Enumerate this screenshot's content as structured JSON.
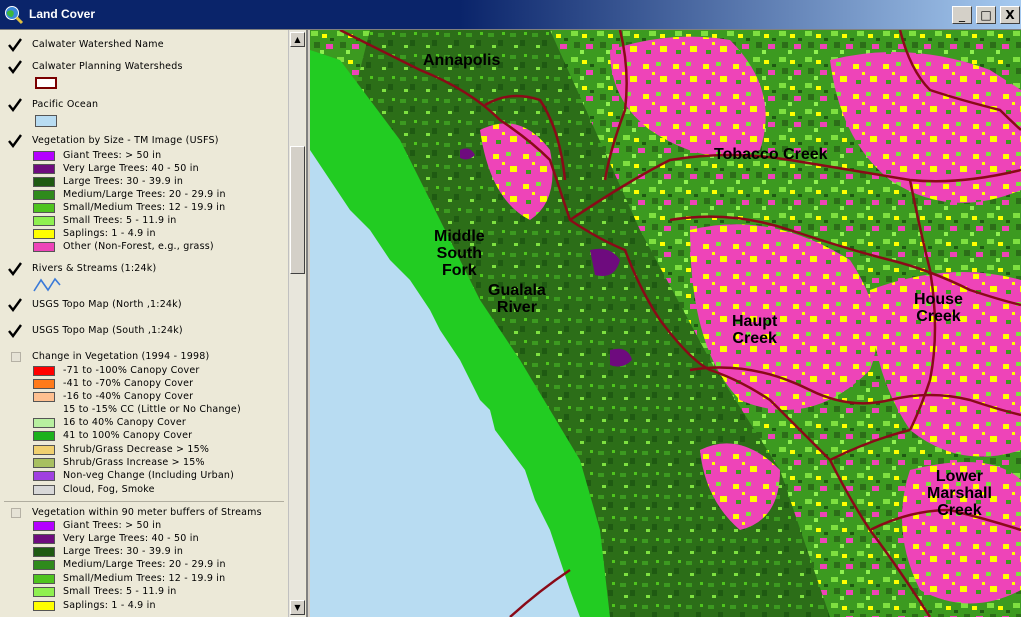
{
  "window": {
    "title": "Land Cover",
    "buttons": {
      "minimize": "_",
      "maximize": "□",
      "close": "X"
    }
  },
  "legend": {
    "layers": [
      {
        "name": "Calwater Watershed Name",
        "checked": true
      },
      {
        "name": "Calwater Planning Watersheds",
        "checked": true,
        "swatch": "#ffffff",
        "swatch_border": "#7a0000"
      },
      {
        "name": "Pacific Ocean",
        "checked": true,
        "swatch": "#b8dcf2"
      },
      {
        "name": "Vegetation by Size - TM Image (USFS)",
        "checked": true,
        "classes": [
          {
            "label": "Giant Trees: > 50 in",
            "color": "#b400ff"
          },
          {
            "label": "Very Large Trees: 40 - 50 in",
            "color": "#6e0b7e"
          },
          {
            "label": "Large Trees: 30 - 39.9 in",
            "color": "#1f5a12"
          },
          {
            "label": "Medium/Large Trees: 20 - 29.9 in",
            "color": "#2f8a1c"
          },
          {
            "label": "Small/Medium Trees: 12 - 19.9 in",
            "color": "#4fc41e"
          },
          {
            "label": "Small Trees: 5 - 11.9 in",
            "color": "#8ff050"
          },
          {
            "label": "Saplings: 1 - 4.9 in",
            "color": "#ffff00"
          },
          {
            "label": "Other (Non-Forest, e.g., grass)",
            "color": "#ee44b8"
          }
        ]
      },
      {
        "name": "Rivers & Streams (1:24k)",
        "checked": true,
        "line_color": "#3a7ad8"
      },
      {
        "name": "USGS Topo Map (North ,1:24k)",
        "checked": true
      },
      {
        "name": "USGS Topo Map (South ,1:24k)",
        "checked": true
      },
      {
        "name": "Change in Vegetation (1994 - 1998)",
        "checked": false,
        "classes": [
          {
            "label": "-71 to -100% Canopy Cover",
            "color": "#ff0000"
          },
          {
            "label": "-41 to -70% Canopy Cover",
            "color": "#ff7a1a"
          },
          {
            "label": "-16 to -40% Canopy Cover",
            "color": "#ffc090"
          },
          {
            "label": "15 to -15% CC (Little or No Change)",
            "color": ""
          },
          {
            "label": "16 to 40% Canopy Cover",
            "color": "#b8f0a0"
          },
          {
            "label": "41 to 100% Canopy Cover",
            "color": "#1cb11c"
          },
          {
            "label": "Shrub/Grass Decrease > 15%",
            "color": "#f0d070"
          },
          {
            "label": "Shrub/Grass Increase > 15%",
            "color": "#a8c060"
          },
          {
            "label": "Non-veg Change (Including Urban)",
            "color": "#a040e0"
          },
          {
            "label": "Cloud, Fog, Smoke",
            "color": "#d8d8d8"
          }
        ]
      },
      {
        "name": "Vegetation within 90 meter buffers of Streams",
        "checked": false,
        "classes": [
          {
            "label": "Giant Trees: > 50 in",
            "color": "#b400ff"
          },
          {
            "label": "Very Large Trees: 40 - 50 in",
            "color": "#6e0b7e"
          },
          {
            "label": "Large Trees: 30 - 39.9 in",
            "color": "#1f5a12"
          },
          {
            "label": "Medium/Large Trees: 20 - 29.9 in",
            "color": "#2f8a1c"
          },
          {
            "label": "Small/Medium Trees: 12 - 19.9 in",
            "color": "#4fc41e"
          },
          {
            "label": "Small Trees: 5 - 11.9 in",
            "color": "#8ff050"
          },
          {
            "label": "Saplings: 1 - 4.9 in",
            "color": "#ffff00"
          }
        ]
      }
    ]
  },
  "map": {
    "labels": [
      {
        "id": "annapolis",
        "text": "Annapolis"
      },
      {
        "id": "tobacco-creek",
        "text": "Tobacco Creek"
      },
      {
        "id": "middle-south-fork",
        "text": "Middle\nSouth\nFork"
      },
      {
        "id": "gualala-river",
        "text": "Gualala\nRiver"
      },
      {
        "id": "haupt-creek",
        "text": "Haupt\nCreek"
      },
      {
        "id": "house-creek",
        "text": "House\nCreek"
      },
      {
        "id": "lower-marshall-creek",
        "text": "Lower\nMarshall\nCreek"
      }
    ],
    "colors": {
      "ocean": "#b8dcf2",
      "coastal_band": "#22cc22",
      "forest_dark": "#2c6e18",
      "forest_mid": "#3c9a20",
      "forest_light": "#7ee040",
      "saplings": "#ffff00",
      "non_forest": "#ee44b8",
      "watershed_line": "#8a0a18"
    }
  }
}
